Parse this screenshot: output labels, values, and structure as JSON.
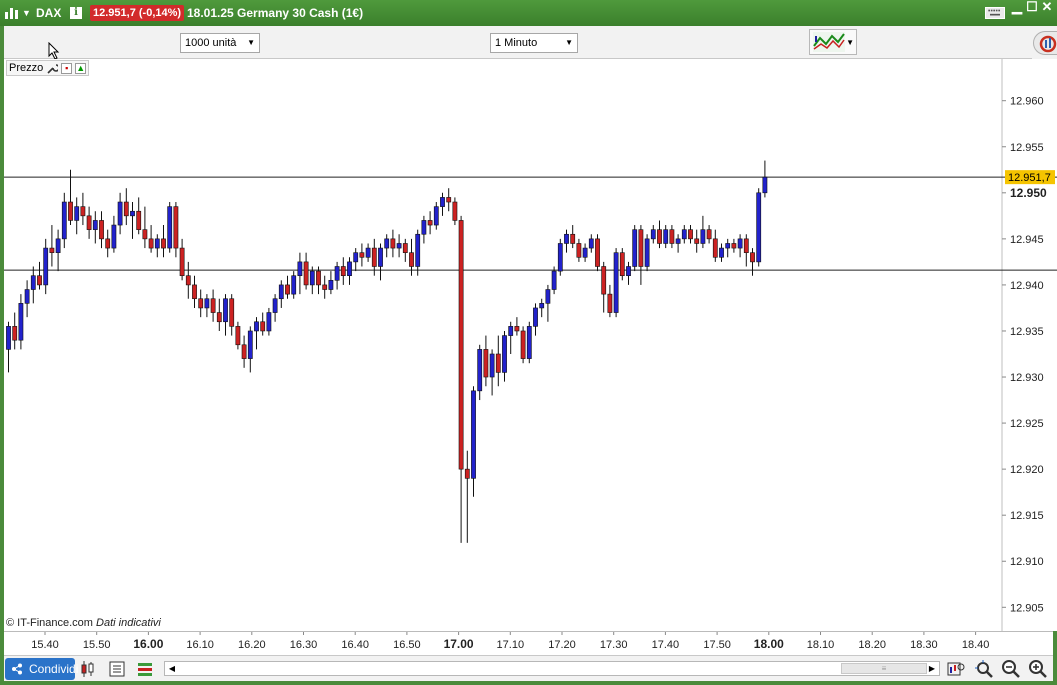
{
  "titlebar": {
    "symbol": "DAX",
    "price_badge": "12.951,7 (-0,14%)",
    "description": "18.01.25 Germany 30 Cash (1€)",
    "icons": [
      "chart-logo-icon",
      "dropdown-icon",
      "info-icon",
      "keyboard-icon",
      "minimize-icon",
      "maximize-icon",
      "close-icon"
    ]
  },
  "toolbar": {
    "units_select": "1000 unità",
    "period_select": "1 Minuto"
  },
  "chart_panel": {
    "price_label": "Prezzo",
    "copyright": "© IT-Finance.com",
    "disclaimer": "Dati indicativi"
  },
  "bottombar": {
    "share_label": "Condividi"
  },
  "colors": {
    "up_candle": "#2222cc",
    "down_candle": "#cc2222",
    "title_green": "#3b7f2c",
    "price_badge_bg": "#d22b2b",
    "current_price_label": "#f5c400"
  },
  "chart_data": {
    "type": "candlestick",
    "title": "",
    "ylim": [
      12902.5,
      12965.5
    ],
    "y_ticks": [
      "12.960",
      "12.955",
      "12.950",
      "12.945",
      "12.940",
      "12.935",
      "12.930",
      "12.925",
      "12.920",
      "12.915",
      "12.910",
      "12.905"
    ],
    "y_ticks_values": [
      12960,
      12955,
      12950,
      12945,
      12940,
      12935,
      12930,
      12925,
      12920,
      12915,
      12910,
      12905
    ],
    "x_ticks": [
      "15.40",
      "15.50",
      "16.00",
      "16.10",
      "16.20",
      "16.30",
      "16.40",
      "16.50",
      "17.00",
      "17.10",
      "17.20",
      "17.30",
      "17.40",
      "17.50",
      "18.00",
      "18.10",
      "18.20",
      "18.30",
      "18.40"
    ],
    "bold_x_ticks": [
      "16.00",
      "17.00",
      "18.00"
    ],
    "current_price": "12.951,7",
    "current_price_value": 12951.7,
    "highlight_level": "12.950",
    "horizontal_lines": [
      12951.7,
      12941.6
    ],
    "candles": [
      {
        "o": 12933.0,
        "h": 12936.0,
        "l": 12930.5,
        "c": 12935.5
      },
      {
        "o": 12935.5,
        "h": 12937.0,
        "l": 12933.0,
        "c": 12934.0
      },
      {
        "o": 12934.0,
        "h": 12939.0,
        "l": 12933.0,
        "c": 12938.0
      },
      {
        "o": 12938.0,
        "h": 12940.5,
        "l": 12936.5,
        "c": 12939.5
      },
      {
        "o": 12939.5,
        "h": 12942.0,
        "l": 12938.0,
        "c": 12941.0
      },
      {
        "o": 12941.0,
        "h": 12942.5,
        "l": 12939.5,
        "c": 12940.0
      },
      {
        "o": 12940.0,
        "h": 12945.0,
        "l": 12939.0,
        "c": 12944.0
      },
      {
        "o": 12944.0,
        "h": 12946.5,
        "l": 12942.0,
        "c": 12943.5
      },
      {
        "o": 12943.5,
        "h": 12946.0,
        "l": 12941.5,
        "c": 12945.0
      },
      {
        "o": 12945.0,
        "h": 12950.0,
        "l": 12944.0,
        "c": 12949.0
      },
      {
        "o": 12949.0,
        "h": 12952.5,
        "l": 12946.5,
        "c": 12947.0
      },
      {
        "o": 12947.0,
        "h": 12949.5,
        "l": 12945.5,
        "c": 12948.5
      },
      {
        "o": 12948.5,
        "h": 12950.0,
        "l": 12946.5,
        "c": 12947.5
      },
      {
        "o": 12947.5,
        "h": 12948.5,
        "l": 12945.0,
        "c": 12946.0
      },
      {
        "o": 12946.0,
        "h": 12948.0,
        "l": 12944.5,
        "c": 12947.0
      },
      {
        "o": 12947.0,
        "h": 12948.0,
        "l": 12944.0,
        "c": 12945.0
      },
      {
        "o": 12945.0,
        "h": 12946.0,
        "l": 12943.0,
        "c": 12944.0
      },
      {
        "o": 12944.0,
        "h": 12947.5,
        "l": 12943.5,
        "c": 12946.5
      },
      {
        "o": 12946.5,
        "h": 12950.0,
        "l": 12945.5,
        "c": 12949.0
      },
      {
        "o": 12949.0,
        "h": 12950.5,
        "l": 12946.5,
        "c": 12947.5
      },
      {
        "o": 12947.5,
        "h": 12949.0,
        "l": 12945.0,
        "c": 12948.0
      },
      {
        "o": 12948.0,
        "h": 12949.5,
        "l": 12945.5,
        "c": 12946.0
      },
      {
        "o": 12946.0,
        "h": 12948.5,
        "l": 12944.0,
        "c": 12945.0
      },
      {
        "o": 12945.0,
        "h": 12946.5,
        "l": 12943.5,
        "c": 12944.0
      },
      {
        "o": 12944.0,
        "h": 12945.5,
        "l": 12943.0,
        "c": 12945.0
      },
      {
        "o": 12945.0,
        "h": 12946.5,
        "l": 12943.0,
        "c": 12944.0
      },
      {
        "o": 12944.0,
        "h": 12949.0,
        "l": 12943.5,
        "c": 12948.5
      },
      {
        "o": 12948.5,
        "h": 12949.0,
        "l": 12943.0,
        "c": 12944.0
      },
      {
        "o": 12944.0,
        "h": 12945.0,
        "l": 12940.5,
        "c": 12941.0
      },
      {
        "o": 12941.0,
        "h": 12942.5,
        "l": 12938.5,
        "c": 12940.0
      },
      {
        "o": 12940.0,
        "h": 12941.0,
        "l": 12937.5,
        "c": 12938.5
      },
      {
        "o": 12938.5,
        "h": 12939.5,
        "l": 12936.5,
        "c": 12937.5
      },
      {
        "o": 12937.5,
        "h": 12939.0,
        "l": 12936.5,
        "c": 12938.5
      },
      {
        "o": 12938.5,
        "h": 12939.5,
        "l": 12936.0,
        "c": 12937.0
      },
      {
        "o": 12937.0,
        "h": 12938.5,
        "l": 12935.0,
        "c": 12936.0
      },
      {
        "o": 12936.0,
        "h": 12939.0,
        "l": 12934.5,
        "c": 12938.5
      },
      {
        "o": 12938.5,
        "h": 12939.0,
        "l": 12934.5,
        "c": 12935.5
      },
      {
        "o": 12935.5,
        "h": 12936.0,
        "l": 12933.0,
        "c": 12933.5
      },
      {
        "o": 12933.5,
        "h": 12934.5,
        "l": 12931.0,
        "c": 12932.0
      },
      {
        "o": 12932.0,
        "h": 12935.5,
        "l": 12930.5,
        "c": 12935.0
      },
      {
        "o": 12935.0,
        "h": 12936.5,
        "l": 12933.0,
        "c": 12936.0
      },
      {
        "o": 12936.0,
        "h": 12937.0,
        "l": 12934.5,
        "c": 12935.0
      },
      {
        "o": 12935.0,
        "h": 12937.5,
        "l": 12934.5,
        "c": 12937.0
      },
      {
        "o": 12937.0,
        "h": 12939.0,
        "l": 12936.0,
        "c": 12938.5
      },
      {
        "o": 12938.5,
        "h": 12940.5,
        "l": 12937.5,
        "c": 12940.0
      },
      {
        "o": 12940.0,
        "h": 12941.0,
        "l": 12938.5,
        "c": 12939.0
      },
      {
        "o": 12939.0,
        "h": 12941.5,
        "l": 12938.5,
        "c": 12941.0
      },
      {
        "o": 12941.0,
        "h": 12943.5,
        "l": 12939.0,
        "c": 12942.5
      },
      {
        "o": 12942.5,
        "h": 12943.5,
        "l": 12939.5,
        "c": 12940.0
      },
      {
        "o": 12940.0,
        "h": 12942.0,
        "l": 12939.0,
        "c": 12941.5
      },
      {
        "o": 12941.5,
        "h": 12942.0,
        "l": 12939.0,
        "c": 12940.0
      },
      {
        "o": 12940.0,
        "h": 12941.0,
        "l": 12938.5,
        "c": 12939.5
      },
      {
        "o": 12939.5,
        "h": 12941.5,
        "l": 12939.0,
        "c": 12940.5
      },
      {
        "o": 12940.5,
        "h": 12942.5,
        "l": 12939.5,
        "c": 12942.0
      },
      {
        "o": 12942.0,
        "h": 12943.0,
        "l": 12940.0,
        "c": 12941.0
      },
      {
        "o": 12941.0,
        "h": 12943.0,
        "l": 12940.0,
        "c": 12942.5
      },
      {
        "o": 12942.5,
        "h": 12944.0,
        "l": 12941.5,
        "c": 12943.5
      },
      {
        "o": 12943.5,
        "h": 12944.5,
        "l": 12942.0,
        "c": 12943.0
      },
      {
        "o": 12943.0,
        "h": 12944.5,
        "l": 12942.5,
        "c": 12944.0
      },
      {
        "o": 12944.0,
        "h": 12945.0,
        "l": 12941.0,
        "c": 12942.0
      },
      {
        "o": 12942.0,
        "h": 12944.5,
        "l": 12940.5,
        "c": 12944.0
      },
      {
        "o": 12944.0,
        "h": 12945.5,
        "l": 12943.0,
        "c": 12945.0
      },
      {
        "o": 12945.0,
        "h": 12946.0,
        "l": 12943.0,
        "c": 12944.0
      },
      {
        "o": 12944.0,
        "h": 12945.5,
        "l": 12943.0,
        "c": 12944.5
      },
      {
        "o": 12944.5,
        "h": 12945.0,
        "l": 12942.5,
        "c": 12943.5
      },
      {
        "o": 12943.5,
        "h": 12945.0,
        "l": 12941.0,
        "c": 12942.0
      },
      {
        "o": 12942.0,
        "h": 12946.0,
        "l": 12941.0,
        "c": 12945.5
      },
      {
        "o": 12945.5,
        "h": 12947.5,
        "l": 12944.5,
        "c": 12947.0
      },
      {
        "o": 12947.0,
        "h": 12948.0,
        "l": 12945.5,
        "c": 12946.5
      },
      {
        "o": 12946.5,
        "h": 12949.0,
        "l": 12946.0,
        "c": 12948.5
      },
      {
        "o": 12948.5,
        "h": 12950.0,
        "l": 12947.5,
        "c": 12949.5
      },
      {
        "o": 12949.5,
        "h": 12950.5,
        "l": 12948.0,
        "c": 12949.0
      },
      {
        "o": 12949.0,
        "h": 12949.5,
        "l": 12946.5,
        "c": 12947.0
      },
      {
        "o": 12947.0,
        "h": 12947.5,
        "l": 12912.0,
        "c": 12920.0
      },
      {
        "o": 12920.0,
        "h": 12922.0,
        "l": 12912.0,
        "c": 12919.0
      },
      {
        "o": 12919.0,
        "h": 12929.0,
        "l": 12917.0,
        "c": 12928.5
      },
      {
        "o": 12928.5,
        "h": 12933.5,
        "l": 12927.5,
        "c": 12933.0
      },
      {
        "o": 12933.0,
        "h": 12934.5,
        "l": 12929.0,
        "c": 12930.0
      },
      {
        "o": 12930.0,
        "h": 12933.0,
        "l": 12928.0,
        "c": 12932.5
      },
      {
        "o": 12932.5,
        "h": 12934.5,
        "l": 12929.0,
        "c": 12930.5
      },
      {
        "o": 12930.5,
        "h": 12935.0,
        "l": 12929.5,
        "c": 12934.5
      },
      {
        "o": 12934.5,
        "h": 12936.0,
        "l": 12932.5,
        "c": 12935.5
      },
      {
        "o": 12935.5,
        "h": 12936.5,
        "l": 12934.5,
        "c": 12935.0
      },
      {
        "o": 12935.0,
        "h": 12935.5,
        "l": 12931.5,
        "c": 12932.0
      },
      {
        "o": 12932.0,
        "h": 12936.0,
        "l": 12931.5,
        "c": 12935.5
      },
      {
        "o": 12935.5,
        "h": 12938.0,
        "l": 12934.5,
        "c": 12937.5
      },
      {
        "o": 12937.5,
        "h": 12938.5,
        "l": 12936.5,
        "c": 12938.0
      },
      {
        "o": 12938.0,
        "h": 12940.0,
        "l": 12936.0,
        "c": 12939.5
      },
      {
        "o": 12939.5,
        "h": 12942.0,
        "l": 12939.0,
        "c": 12941.5
      },
      {
        "o": 12941.5,
        "h": 12945.0,
        "l": 12941.0,
        "c": 12944.5
      },
      {
        "o": 12944.5,
        "h": 12946.0,
        "l": 12943.5,
        "c": 12945.5
      },
      {
        "o": 12945.5,
        "h": 12946.5,
        "l": 12944.0,
        "c": 12944.5
      },
      {
        "o": 12944.5,
        "h": 12945.0,
        "l": 12942.5,
        "c": 12943.0
      },
      {
        "o": 12943.0,
        "h": 12944.5,
        "l": 12942.5,
        "c": 12944.0
      },
      {
        "o": 12944.0,
        "h": 12945.5,
        "l": 12943.5,
        "c": 12945.0
      },
      {
        "o": 12945.0,
        "h": 12945.5,
        "l": 12941.5,
        "c": 12942.0
      },
      {
        "o": 12942.0,
        "h": 12942.5,
        "l": 12937.0,
        "c": 12939.0
      },
      {
        "o": 12939.0,
        "h": 12940.0,
        "l": 12936.5,
        "c": 12937.0
      },
      {
        "o": 12937.0,
        "h": 12944.0,
        "l": 12936.5,
        "c": 12943.5
      },
      {
        "o": 12943.5,
        "h": 12944.0,
        "l": 12940.5,
        "c": 12941.0
      },
      {
        "o": 12941.0,
        "h": 12942.5,
        "l": 12940.0,
        "c": 12942.0
      },
      {
        "o": 12942.0,
        "h": 12946.5,
        "l": 12941.5,
        "c": 12946.0
      },
      {
        "o": 12946.0,
        "h": 12946.5,
        "l": 12940.0,
        "c": 12942.0
      },
      {
        "o": 12942.0,
        "h": 12945.5,
        "l": 12941.5,
        "c": 12945.0
      },
      {
        "o": 12945.0,
        "h": 12946.5,
        "l": 12944.5,
        "c": 12946.0
      },
      {
        "o": 12946.0,
        "h": 12947.0,
        "l": 12944.0,
        "c": 12944.5
      },
      {
        "o": 12944.5,
        "h": 12946.5,
        "l": 12944.0,
        "c": 12946.0
      },
      {
        "o": 12946.0,
        "h": 12946.5,
        "l": 12944.0,
        "c": 12944.5
      },
      {
        "o": 12944.5,
        "h": 12945.5,
        "l": 12943.5,
        "c": 12945.0
      },
      {
        "o": 12945.0,
        "h": 12946.5,
        "l": 12944.5,
        "c": 12946.0
      },
      {
        "o": 12946.0,
        "h": 12946.5,
        "l": 12944.5,
        "c": 12945.0
      },
      {
        "o": 12945.0,
        "h": 12946.0,
        "l": 12943.5,
        "c": 12944.5
      },
      {
        "o": 12944.5,
        "h": 12947.5,
        "l": 12944.0,
        "c": 12946.0
      },
      {
        "o": 12946.0,
        "h": 12946.5,
        "l": 12944.5,
        "c": 12945.0
      },
      {
        "o": 12945.0,
        "h": 12946.0,
        "l": 12942.5,
        "c": 12943.0
      },
      {
        "o": 12943.0,
        "h": 12944.5,
        "l": 12942.5,
        "c": 12944.0
      },
      {
        "o": 12944.0,
        "h": 12945.0,
        "l": 12943.0,
        "c": 12944.5
      },
      {
        "o": 12944.5,
        "h": 12945.0,
        "l": 12943.5,
        "c": 12944.0
      },
      {
        "o": 12944.0,
        "h": 12945.5,
        "l": 12943.0,
        "c": 12945.0
      },
      {
        "o": 12945.0,
        "h": 12945.5,
        "l": 12942.0,
        "c": 12943.5
      },
      {
        "o": 12943.5,
        "h": 12944.0,
        "l": 12941.0,
        "c": 12942.5
      },
      {
        "o": 12942.5,
        "h": 12950.5,
        "l": 12942.0,
        "c": 12950.0
      },
      {
        "o": 12950.0,
        "h": 12953.5,
        "l": 12949.5,
        "c": 12951.7
      }
    ]
  }
}
